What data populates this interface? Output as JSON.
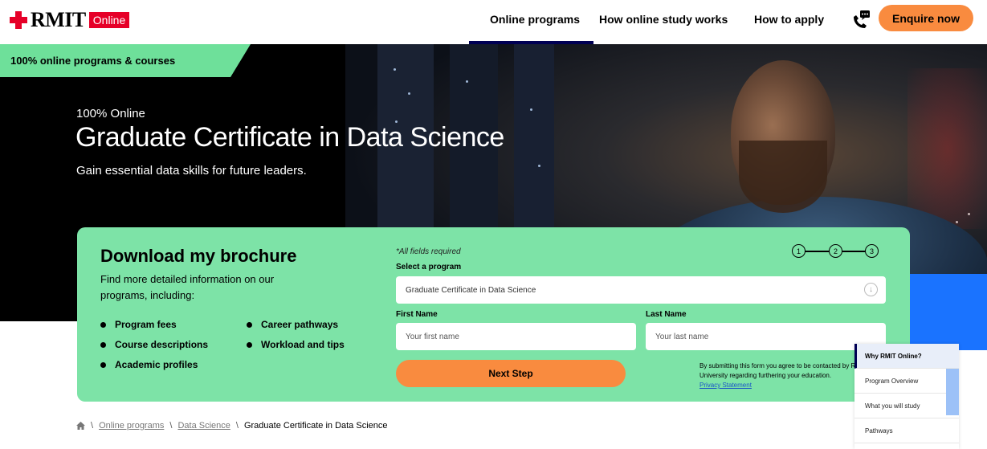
{
  "header": {
    "logo_text": "RMIT",
    "logo_badge": "Online",
    "nav": [
      "Online programs",
      "How online study works",
      "How to apply"
    ],
    "active_nav": "Online programs",
    "enquire_label": "Enquire now",
    "contact_icon": "phone-chat-icon"
  },
  "hero": {
    "tag": "100% online programs & courses",
    "kicker": "100% Online",
    "title": "Graduate Certificate in Data Science",
    "subtitle": "Gain essential data skills for future leaders."
  },
  "brochure": {
    "title": "Download my brochure",
    "description": "Find more detailed information on our programs, including:",
    "bullets_left": [
      "Program fees",
      "Course descriptions",
      "Academic profiles"
    ],
    "bullets_right": [
      "Career pathways",
      "Workload and tips"
    ]
  },
  "form": {
    "required_note": "*All fields required",
    "program_label": "Select a program",
    "program_value": "Graduate Certificate in Data Science",
    "first_name_label": "First Name",
    "first_name_placeholder": "Your first name",
    "last_name_label": "Last Name",
    "last_name_placeholder": "Your last name",
    "steps": [
      "1",
      "2",
      "3"
    ],
    "next_label": "Next Step",
    "consent_text": "By submitting this form you agree to be contacted by RMIT University regarding furthering your education.",
    "privacy_link": "Privacy Statement"
  },
  "side_menu": {
    "items": [
      "Why RMIT Online?",
      "Program Overview",
      "What you will study",
      "Pathways"
    ],
    "active": "Why RMIT Online?"
  },
  "breadcrumb": {
    "links": [
      "Online programs",
      "Data Science"
    ],
    "current": "Graduate Certificate in Data Science"
  },
  "colors": {
    "brand_red": "#e60028",
    "accent_orange": "#f98b3f",
    "accent_green": "#7de3a7",
    "accent_blue": "#1a73ff",
    "nav_active": "#000054"
  }
}
